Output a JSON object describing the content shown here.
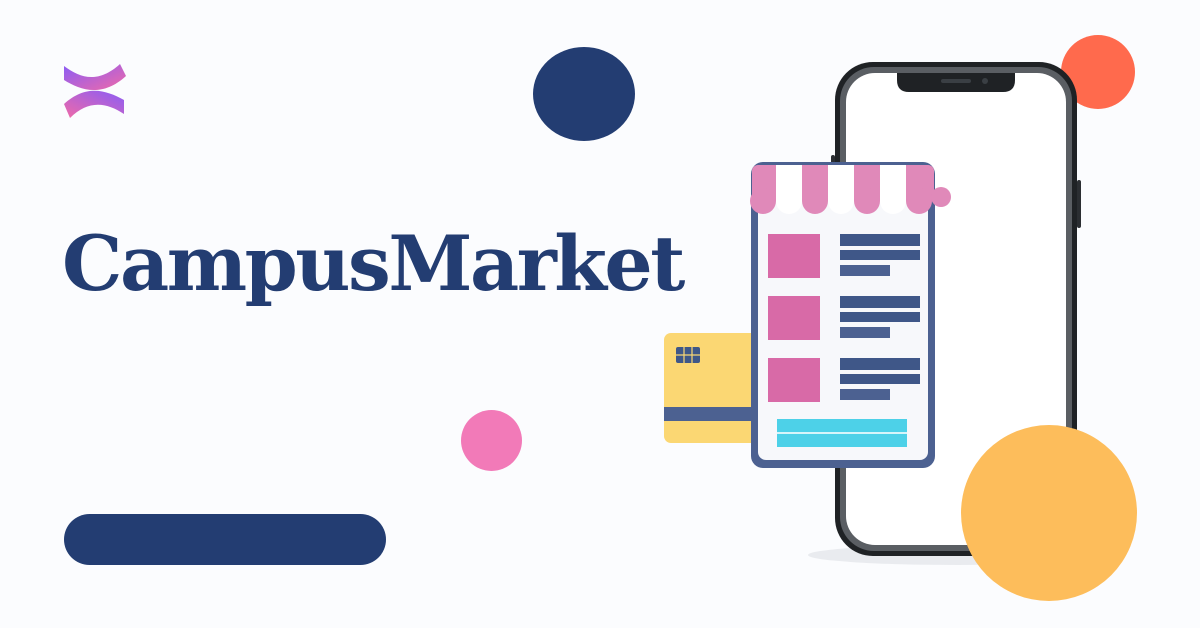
{
  "brand": {
    "name": "CampusMarket",
    "logo_icon": "confluence-logo-icon"
  },
  "colors": {
    "navy": "#233d72",
    "pink": "#f27ab8",
    "orange": "#ff6a4d",
    "yellow": "#fdbd5b",
    "card_yellow": "#fbd773",
    "awning_pink": "#e089b9",
    "cyan": "#4dd1e8"
  },
  "illustration": {
    "icon": "mobile-shop-illustration"
  }
}
